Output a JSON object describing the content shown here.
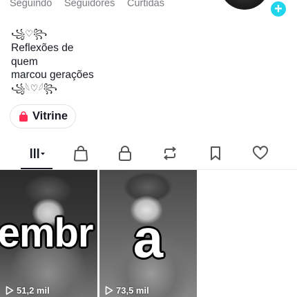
{
  "stats": {
    "following_label": "Seguindo",
    "followers_label": "Seguidores",
    "likes_label": "Curtidas"
  },
  "bio": {
    "ornament_top": "꧁♡꧂",
    "line1": "Reflexões de",
    "line2": "quem",
    "line3": "marcou gerações",
    "ornament_bottom": "꧁𓆩♡𓆪꧂"
  },
  "showcase": {
    "label": "Vitrine",
    "icon": "shopping-bag-icon",
    "icon_color": "#fe2c55"
  },
  "tabs": [
    {
      "name": "videos",
      "icon": "grid-bars-icon",
      "active": true,
      "has_dropdown": true
    },
    {
      "name": "shop",
      "icon": "shopping-bag-outline-icon"
    },
    {
      "name": "private",
      "icon": "lock-icon"
    },
    {
      "name": "reposts",
      "icon": "repost-icon"
    },
    {
      "name": "favorites",
      "icon": "bookmark-icon"
    },
    {
      "name": "liked",
      "icon": "heart-icon"
    }
  ],
  "videos": [
    {
      "overlay_text": "embr",
      "views": "51,2 mil"
    },
    {
      "overlay_text": "a",
      "views": "73,5 mil"
    }
  ],
  "colors": {
    "accent": "#20d5ec",
    "text_primary": "#161823",
    "text_secondary": "#7a7b80"
  }
}
